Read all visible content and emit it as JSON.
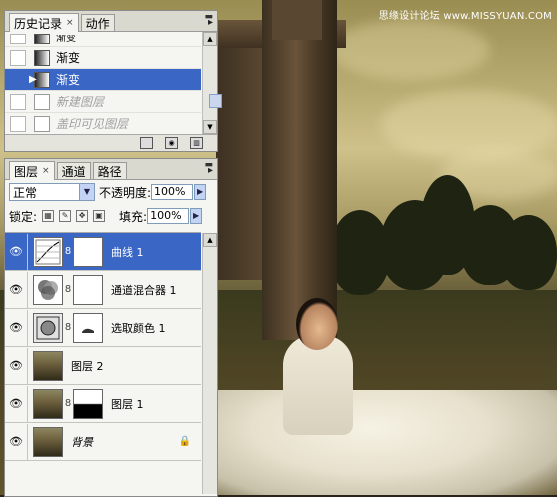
{
  "watermark": "思缘设计论坛 www.MISSYUAN.COM",
  "history_panel": {
    "tabs": [
      {
        "label": "历史记录",
        "active": true,
        "close": "×"
      },
      {
        "label": "动作",
        "active": false
      }
    ],
    "items": [
      {
        "label": "渐变",
        "icon": "gradient-icon",
        "state": "normal"
      },
      {
        "label": "渐变",
        "icon": "gradient-icon",
        "state": "normal"
      },
      {
        "label": "渐变",
        "icon": "gradient-icon",
        "state": "selected"
      },
      {
        "label": "新建图层",
        "icon": "document-icon",
        "state": "ghost"
      },
      {
        "label": "盖印可见图层",
        "icon": "document-icon",
        "state": "ghost"
      }
    ]
  },
  "layers_panel": {
    "tabs": [
      {
        "label": "图层",
        "active": true,
        "close": "×"
      },
      {
        "label": "通道",
        "active": false
      },
      {
        "label": "路径",
        "active": false
      }
    ],
    "blend_mode": "正常",
    "opacity_label": "不透明度:",
    "opacity_value": "100%",
    "lock_label": "锁定:",
    "fill_label": "填充:",
    "fill_value": "100%",
    "layers": [
      {
        "name": "曲线 1",
        "type": "adjustment-curves",
        "mask": "white",
        "selected": true
      },
      {
        "name": "通道混合器 1",
        "type": "adjustment-mixer",
        "mask": "white",
        "selected": false
      },
      {
        "name": "选取颜色 1",
        "type": "adjustment-selective",
        "mask": "white",
        "selected": false
      },
      {
        "name": "图层 2",
        "type": "pixel",
        "mask": null,
        "selected": false
      },
      {
        "name": "图层 1",
        "type": "pixel",
        "mask": "black-white",
        "selected": false
      },
      {
        "name": "背景",
        "type": "background",
        "mask": null,
        "selected": false,
        "locked": true
      }
    ]
  },
  "colors": {
    "selection": "#3a66c6",
    "panel_bg": "#f5f5f2"
  }
}
